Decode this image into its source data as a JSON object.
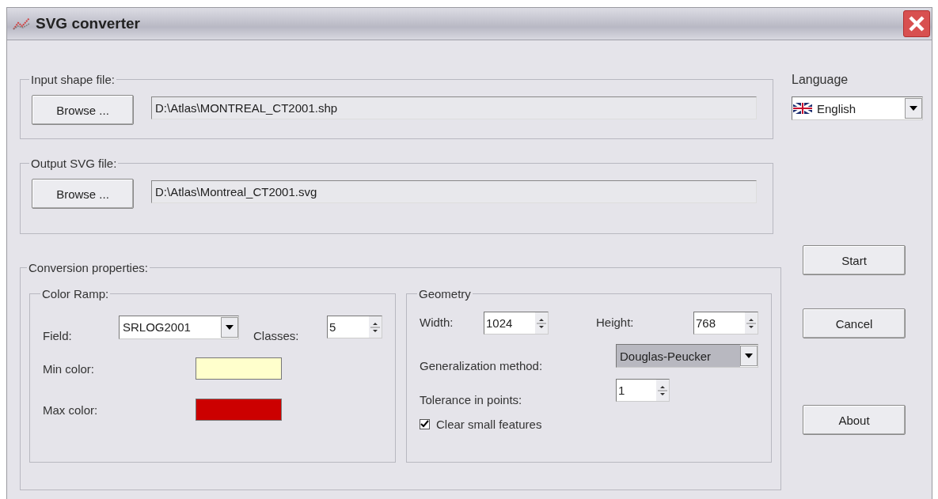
{
  "window": {
    "title": "SVG converter"
  },
  "input_group": {
    "legend": "Input shape file:",
    "button": "Browse ...",
    "value": "D:\\Atlas\\MONTREAL_CT2001.shp"
  },
  "output_group": {
    "legend": "Output SVG file:",
    "button": "Browse ...",
    "value": "D:\\Atlas\\Montreal_CT2001.svg"
  },
  "conversion": {
    "legend": "Conversion properties:",
    "color_ramp": {
      "legend": "Color Ramp:",
      "field_label": "Field:",
      "field_value": "SRLOG2001",
      "classes_label": "Classes:",
      "classes_value": "5",
      "colors": [
        {
          "label": "Min color:",
          "color": "#ffffcc"
        },
        {
          "label": "Max color:",
          "color": "#cc0000"
        }
      ]
    },
    "geometry": {
      "legend": "Geometry",
      "width_label": "Width:",
      "width_value": "1024",
      "height_label": "Height:",
      "height_value": "768",
      "method_label": "Generalization method:",
      "method_value": "Douglas-Peucker",
      "tolerance_label": "Tolerance in points:",
      "tolerance_value": "1",
      "clear_label": "Clear small features",
      "clear_checked": true
    }
  },
  "language": {
    "label": "Language",
    "value": "English"
  },
  "buttons": [
    "Start",
    "Cancel",
    "About"
  ]
}
